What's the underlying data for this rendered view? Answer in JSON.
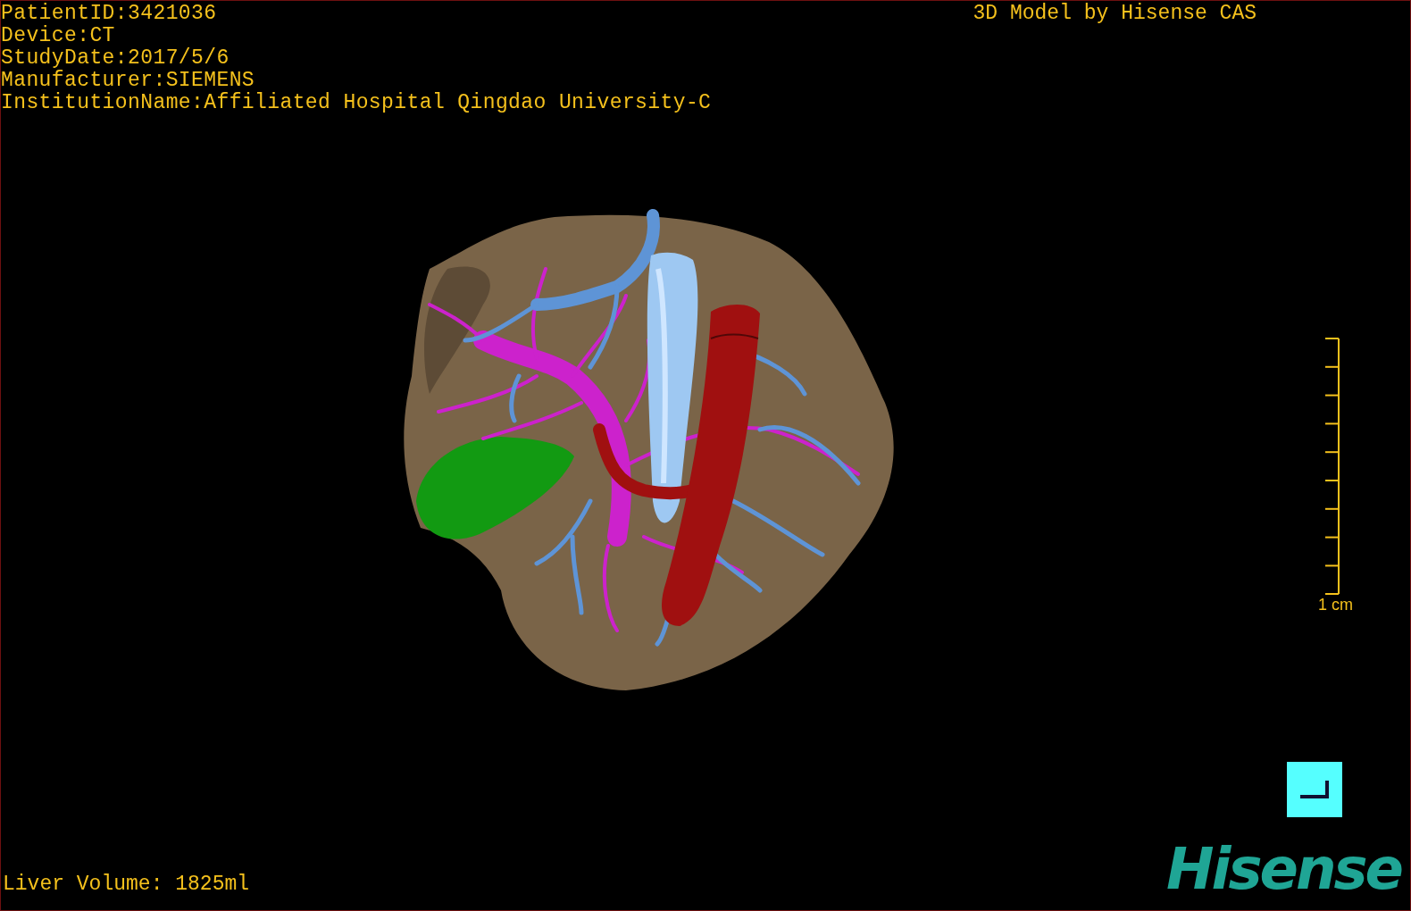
{
  "patient_info": [
    "PatientID:3421036",
    "Device:CT",
    "StudyDate:2017/5/6",
    "Manufacturer:SIEMENS",
    "InstitutionName:Affiliated Hospital Qingdao University-C"
  ],
  "title": "3D Model by Hisense CAS",
  "scale_bar": {
    "label": "1 cm"
  },
  "liver_volume": "Liver Volume: 1825ml",
  "logo": "Hisense"
}
